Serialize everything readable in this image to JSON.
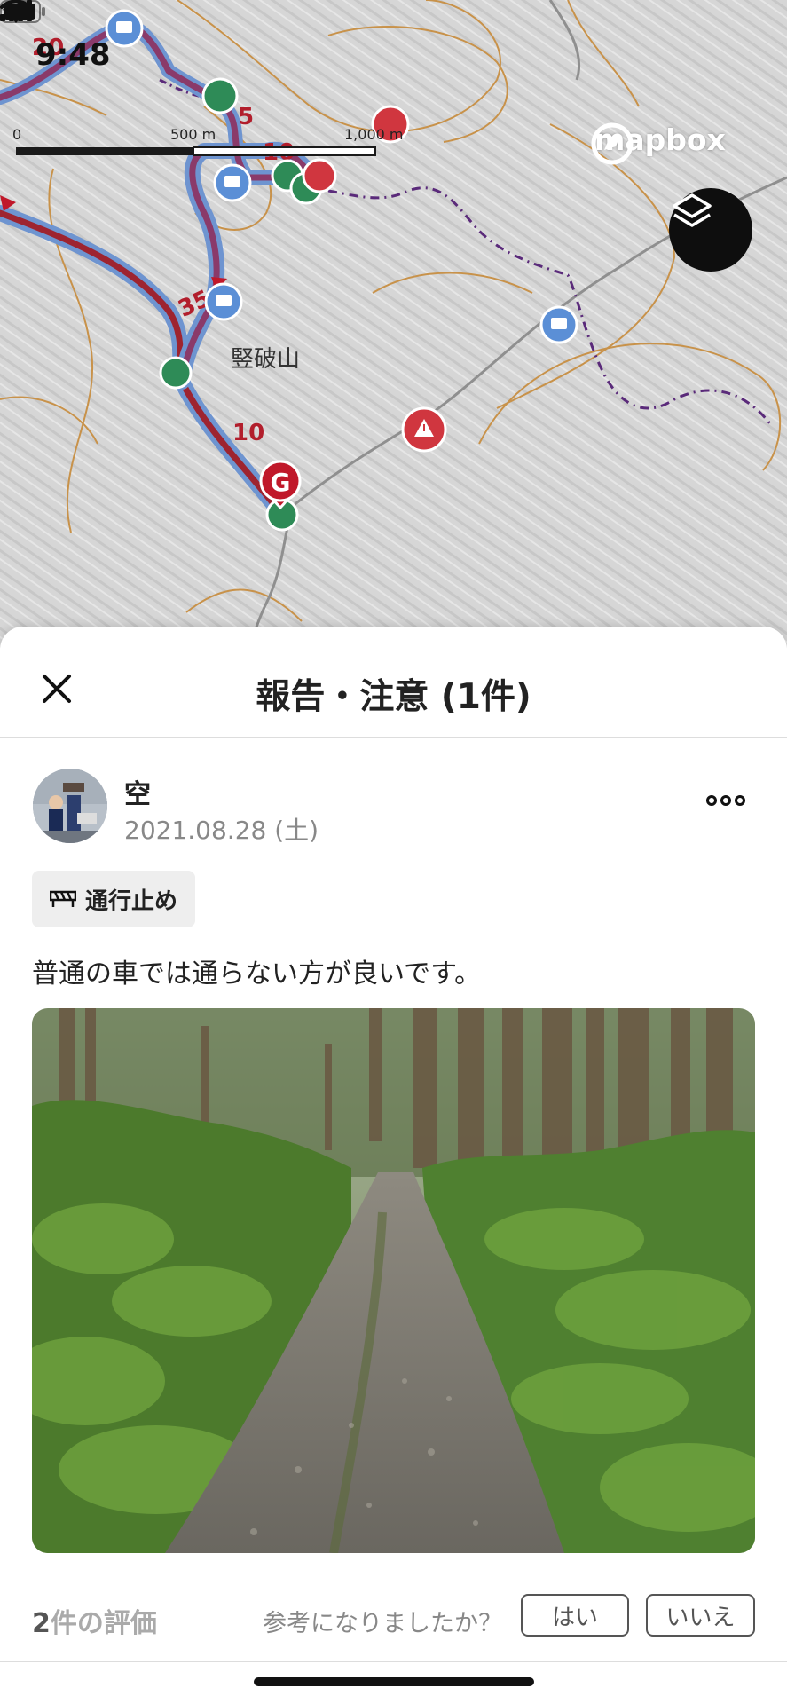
{
  "status_bar": {
    "time": "9:48"
  },
  "map": {
    "scale_labels": [
      "0",
      "500 m",
      "1,000 m"
    ],
    "attribution": "mapbox",
    "peak_name": "竪破山",
    "route_markers": [
      "20",
      "5",
      "10",
      "35",
      "10"
    ],
    "goal_marker": "G",
    "icons": [
      "location-arrow-icon",
      "layers-icon",
      "warning-icon",
      "comment-icon",
      "tree-icon",
      "hiker-icon"
    ]
  },
  "sheet": {
    "title": "報告・注意 (1件)",
    "post": {
      "user_name": "空",
      "date": "2021.08.28 (土)",
      "tag_label": "通行止め",
      "comment": "普通の車では通らない方が良いです。"
    },
    "rating": {
      "count": "2",
      "count_suffix": "件の評価",
      "question": "参考になりましたか？",
      "yes_label": "はい",
      "no_label": "いいえ"
    }
  },
  "colors": {
    "route_red": "#9e2430",
    "route_blue": "#6e94d0",
    "warning_red": "#d0363f",
    "marker_green": "#2e8b57"
  }
}
